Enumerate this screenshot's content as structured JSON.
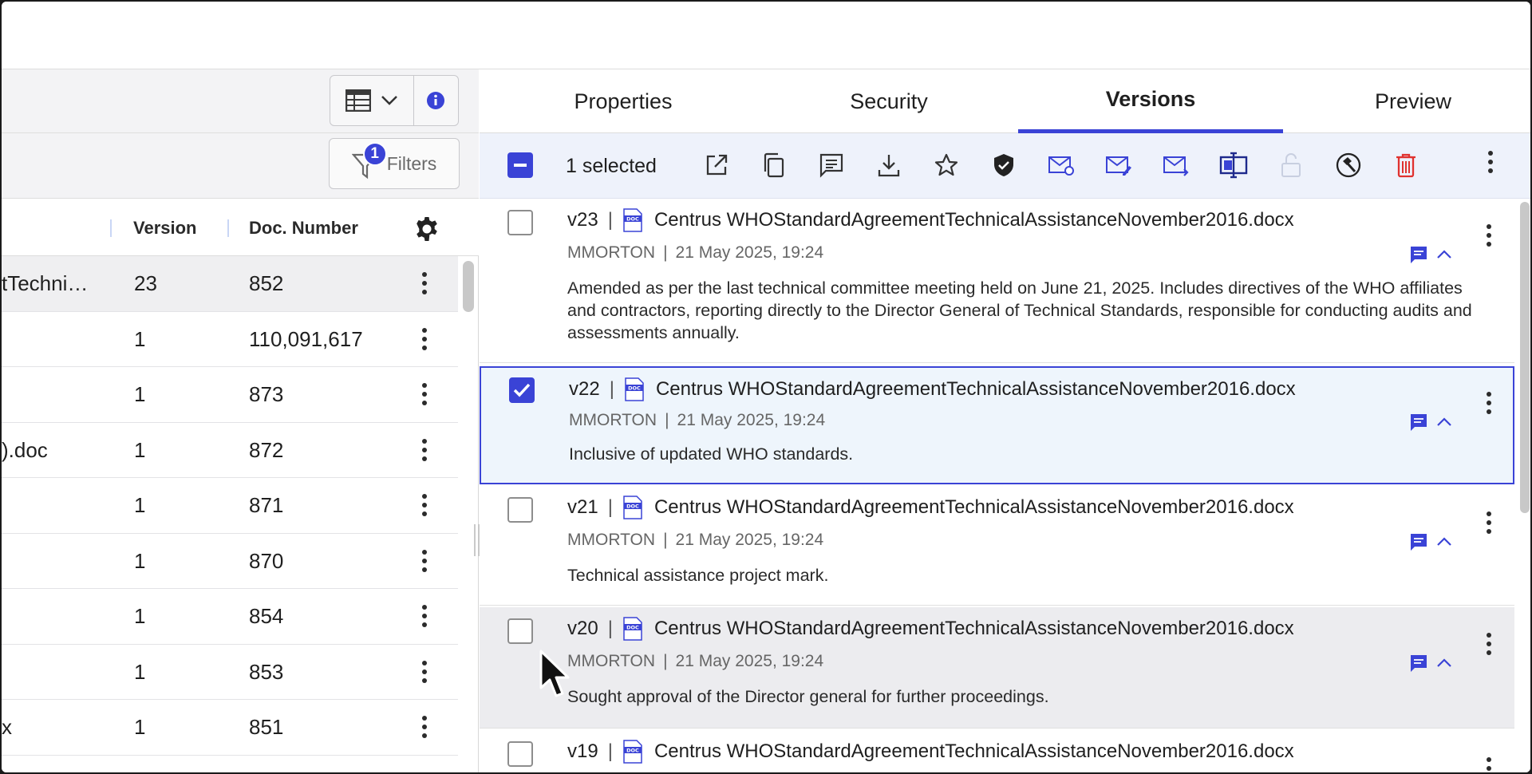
{
  "left": {
    "columns": {
      "version": "Version",
      "doc_number": "Doc. Number"
    },
    "filter_label": "Filters",
    "filter_count": "1",
    "rows": [
      {
        "name": "tTechni…",
        "version": "23",
        "doc_number": "852"
      },
      {
        "name": "",
        "version": "1",
        "doc_number": "110,091,617"
      },
      {
        "name": "",
        "version": "1",
        "doc_number": "873"
      },
      {
        "name": ").doc",
        "version": "1",
        "doc_number": "872"
      },
      {
        "name": "",
        "version": "1",
        "doc_number": "871"
      },
      {
        "name": "",
        "version": "1",
        "doc_number": "870"
      },
      {
        "name": "",
        "version": "1",
        "doc_number": "854"
      },
      {
        "name": "",
        "version": "1",
        "doc_number": "853"
      },
      {
        "name": "x",
        "version": "1",
        "doc_number": "851"
      }
    ]
  },
  "tabs": {
    "properties": "Properties",
    "security": "Security",
    "versions": "Versions",
    "preview": "Preview"
  },
  "toolbar": {
    "selected": "1 selected",
    "icons": [
      "open-external-icon",
      "copy-icon",
      "comment-icon",
      "download-icon",
      "star-icon",
      "shield-icon",
      "mail-link-icon",
      "mail-edit-icon",
      "mail-send-icon",
      "compare-icon",
      "unlock-icon",
      "hammer-icon",
      "trash-icon"
    ]
  },
  "versions": [
    {
      "version": "v23",
      "filename": "Centrus WHOStandardAgreementTechnicalAssistanceNovember2016.docx",
      "user": "MMORTON",
      "date": "21 May 2025, 19:24",
      "description": "Amended as per the last technical committee meeting held on June 21, 2025. Includes directives of the WHO affiliates and contractors, reporting directly to the Director General of Technical Standards, responsible for conducting audits and assessments annually.",
      "checked": false
    },
    {
      "version": "v22",
      "filename": "Centrus WHOStandardAgreementTechnicalAssistanceNovember2016.docx",
      "user": "MMORTON",
      "date": "21 May 2025, 19:24",
      "description": "Inclusive of updated WHO standards.",
      "checked": true
    },
    {
      "version": "v21",
      "filename": "Centrus WHOStandardAgreementTechnicalAssistanceNovember2016.docx",
      "user": "MMORTON",
      "date": "21 May 2025, 19:24",
      "description": "Technical assistance project mark.",
      "checked": false
    },
    {
      "version": "v20",
      "filename": "Centrus WHOStandardAgreementTechnicalAssistanceNovember2016.docx",
      "user": "MMORTON",
      "date": "21 May 2025, 19:24",
      "description": "Sought approval of the Director general for further proceedings.",
      "checked": false
    },
    {
      "version": "v19",
      "filename": "Centrus WHOStandardAgreementTechnicalAssistanceNovember2016.docx",
      "user": "",
      "date": "",
      "description": "",
      "checked": false
    }
  ],
  "doc_icon_label": "DOC",
  "colors": {
    "accent": "#3a43d6",
    "danger": "#e0322f"
  }
}
